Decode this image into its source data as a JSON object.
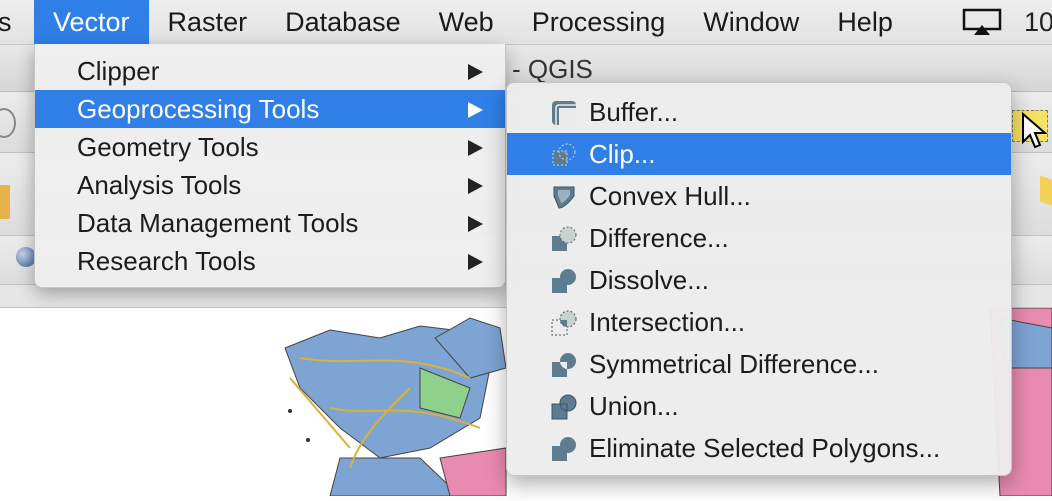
{
  "menubar": {
    "items": [
      {
        "label": "s"
      },
      {
        "label": "Vector"
      },
      {
        "label": "Raster"
      },
      {
        "label": "Database"
      },
      {
        "label": "Web"
      },
      {
        "label": "Processing"
      },
      {
        "label": "Window"
      },
      {
        "label": "Help"
      }
    ],
    "airplay_icon": "airplay-icon",
    "clock_partial": "10"
  },
  "window": {
    "title_partial": "- QGIS"
  },
  "vector_menu": {
    "items": [
      {
        "label": "Clipper",
        "has_submenu": true
      },
      {
        "label": "Geoprocessing Tools",
        "has_submenu": true,
        "selected": true
      },
      {
        "label": "Geometry Tools",
        "has_submenu": true
      },
      {
        "label": "Analysis Tools",
        "has_submenu": true
      },
      {
        "label": "Data Management Tools",
        "has_submenu": true
      },
      {
        "label": "Research Tools",
        "has_submenu": true
      }
    ]
  },
  "geoprocessing_submenu": {
    "items": [
      {
        "label": "Buffer...",
        "icon": "buffer-icon"
      },
      {
        "label": "Clip...",
        "icon": "clip-icon",
        "selected": true
      },
      {
        "label": "Convex Hull...",
        "icon": "convex-hull-icon"
      },
      {
        "label": "Difference...",
        "icon": "difference-icon"
      },
      {
        "label": "Dissolve...",
        "icon": "dissolve-icon"
      },
      {
        "label": "Intersection...",
        "icon": "intersection-icon"
      },
      {
        "label": "Symmetrical Difference...",
        "icon": "symmetrical-difference-icon"
      },
      {
        "label": "Union...",
        "icon": "union-icon"
      },
      {
        "label": "Eliminate Selected Polygons...",
        "icon": "eliminate-polygons-icon"
      }
    ]
  },
  "colors": {
    "selection": "#2f7fe6",
    "icon_fill": "#5e7c90",
    "map_blue": "#7ea4d3",
    "map_pink": "#e98bb0",
    "map_green": "#8fd08a"
  }
}
